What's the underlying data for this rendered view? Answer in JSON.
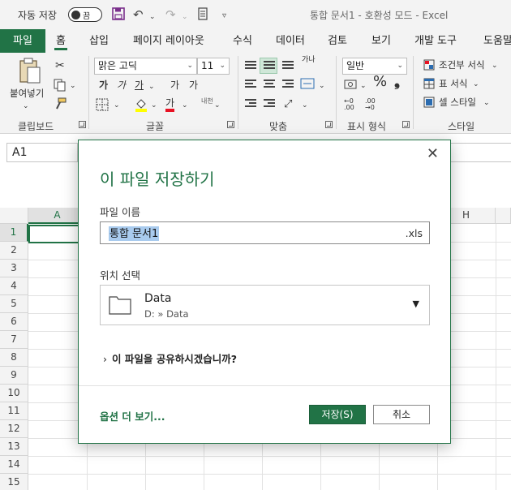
{
  "titlebar": {
    "autosave_label": "자동 저장",
    "autosave_state": "끔",
    "doc_title": "통합 문서1  -  호환성 모드  -  Excel"
  },
  "tabs": [
    "파일",
    "홈",
    "삽입",
    "페이지 레이아웃",
    "수식",
    "데이터",
    "검토",
    "보기",
    "개발 도구",
    "도움말"
  ],
  "ribbon": {
    "clipboard": {
      "paste_label": "붙여넣기",
      "group_label": "클립보드"
    },
    "font": {
      "name": "맑은 고딕",
      "size": "11",
      "group_label": "글꼴",
      "bold": "가",
      "italic": "가",
      "underline": "가",
      "grow": "가",
      "shrink": "가",
      "phonetic": "내천",
      "color_letter": "가"
    },
    "alignment": {
      "group_label": "맞춤",
      "wrap": "가나"
    },
    "number": {
      "format": "일반",
      "group_label": "표시 형식"
    },
    "styles": {
      "conditional": "조건부 서식",
      "table": "표 서식",
      "cell": "셀 스타일",
      "group_label": "스타일"
    }
  },
  "namebox": {
    "value": "A1"
  },
  "grid": {
    "columns": [
      "A",
      "H"
    ],
    "rows": [
      "1",
      "2",
      "3",
      "4",
      "5",
      "6",
      "7",
      "8",
      "9",
      "10",
      "11",
      "12",
      "13",
      "14",
      "15"
    ]
  },
  "dialog": {
    "title": "이 파일 저장하기",
    "filename_label": "파일 이름",
    "filename_value": "통합 문서1",
    "extension": ".xls",
    "location_label": "위치 선택",
    "location_name": "Data",
    "location_path": "D: » Data",
    "share_text": "이 파일을 공유하시겠습니까?",
    "more_options": "옵션 더 보기...",
    "save_button": "저장(S)",
    "cancel_button": "취소",
    "accent_color": "#217346"
  }
}
